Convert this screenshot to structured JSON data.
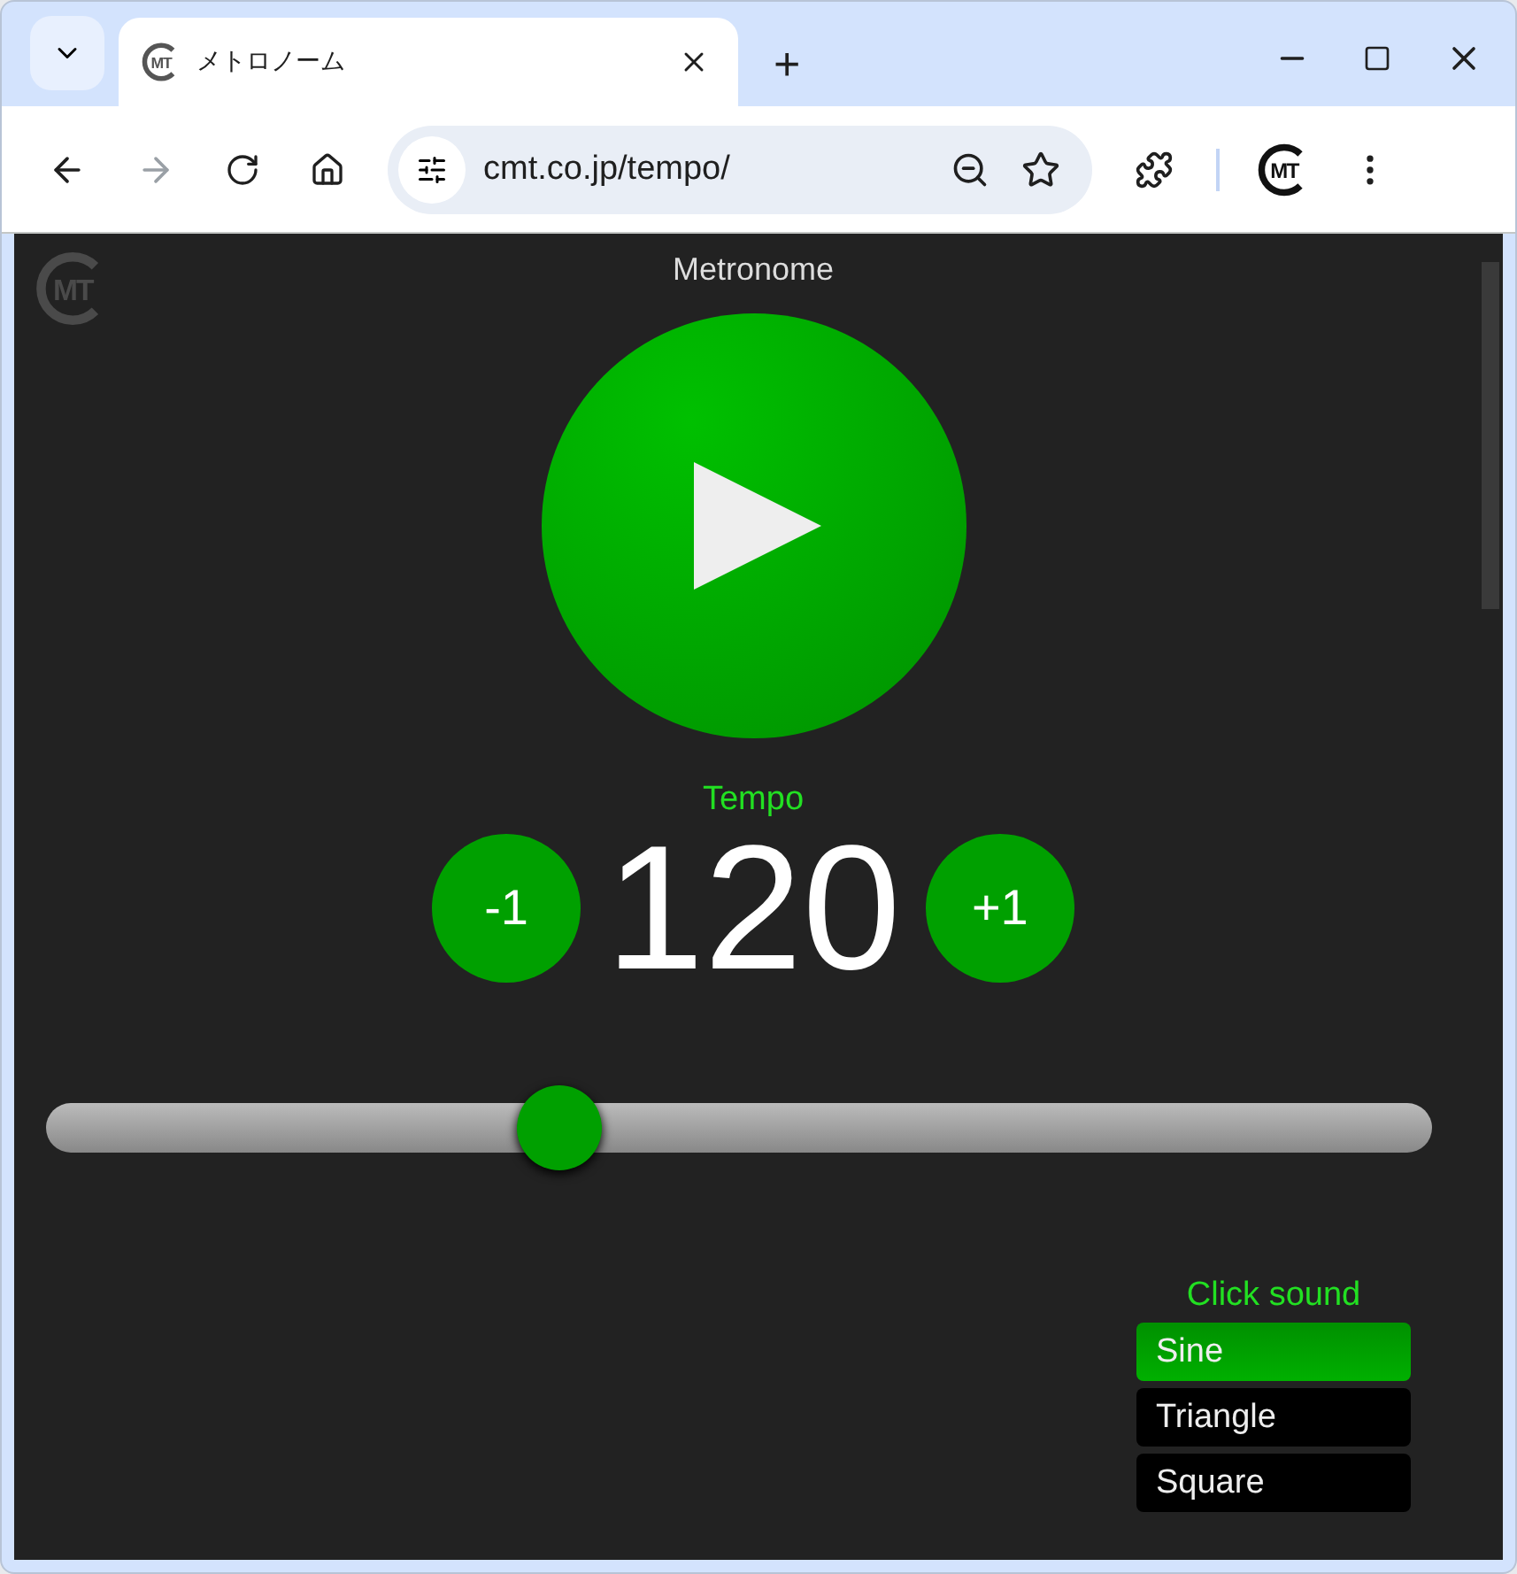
{
  "browser": {
    "tab": {
      "favicon_text": "MT",
      "title": "メトロノーム",
      "selected": true
    },
    "new_tab": "+",
    "address": "cmt.co.jp/tempo/",
    "profile_text": "MT"
  },
  "page": {
    "logo_text": "MT",
    "title": "Metronome",
    "playing": false,
    "tempo": {
      "label": "Tempo",
      "value": "120",
      "minus": "-1",
      "plus": "+1",
      "level": 0.37
    },
    "click_sound": {
      "label": "Click sound",
      "options": [
        {
          "label": "Sine",
          "selected": true
        },
        {
          "label": "Triangle",
          "selected": false
        },
        {
          "label": "Square",
          "selected": false
        }
      ]
    }
  }
}
